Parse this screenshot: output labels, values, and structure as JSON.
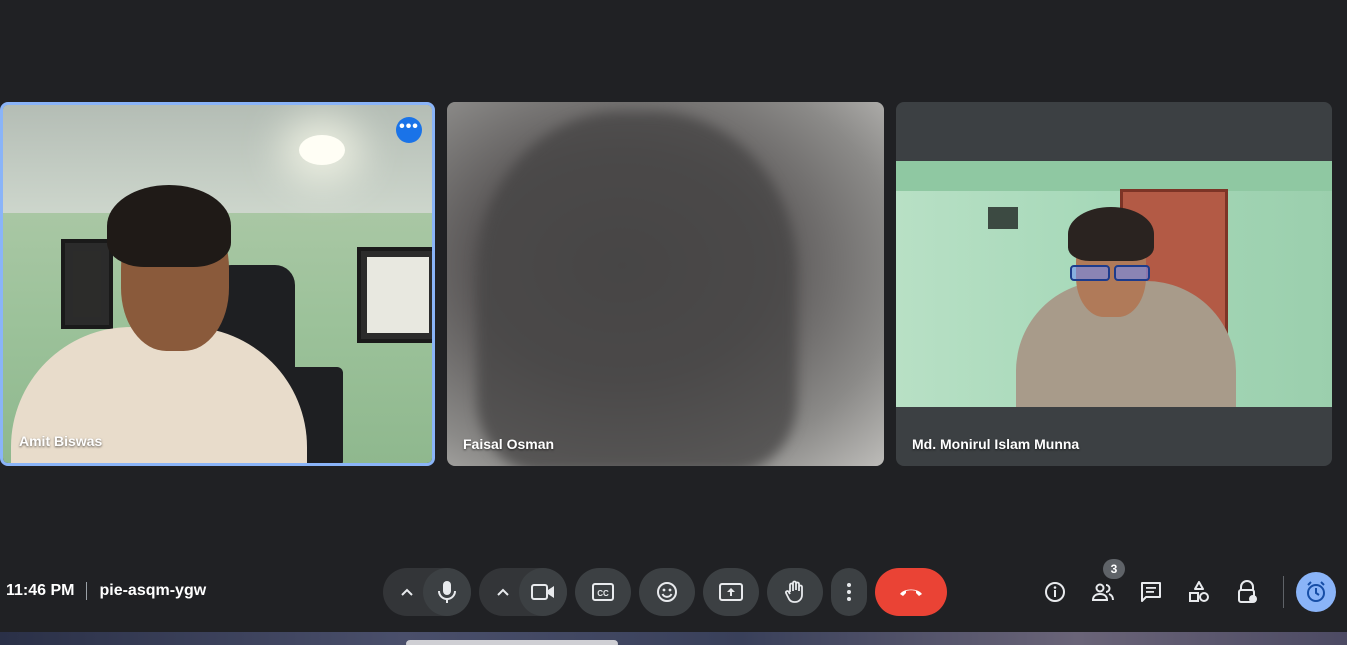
{
  "participants": [
    {
      "name": "Amit Biswas",
      "active_speaker": true
    },
    {
      "name": "Faisal Osman",
      "active_speaker": false
    },
    {
      "name": "Md. Monirul Islam Munna",
      "active_speaker": false
    }
  ],
  "meeting": {
    "time": "11:46 PM",
    "code": "pie-asqm-ygw"
  },
  "people_count": "3",
  "more_options_glyph": "•••",
  "colors": {
    "accent": "#8ab4f8",
    "end_call": "#ea4335",
    "background": "#202124",
    "control": "#3c4043"
  },
  "controls": [
    "mic-icon",
    "camera-icon",
    "captions-icon",
    "emoji-icon",
    "present-icon",
    "raise-hand-icon",
    "more-vert-icon",
    "end-call-icon"
  ],
  "side_controls": [
    "info-icon",
    "people-icon",
    "chat-icon",
    "activities-icon",
    "host-controls-icon",
    "timer-icon"
  ]
}
